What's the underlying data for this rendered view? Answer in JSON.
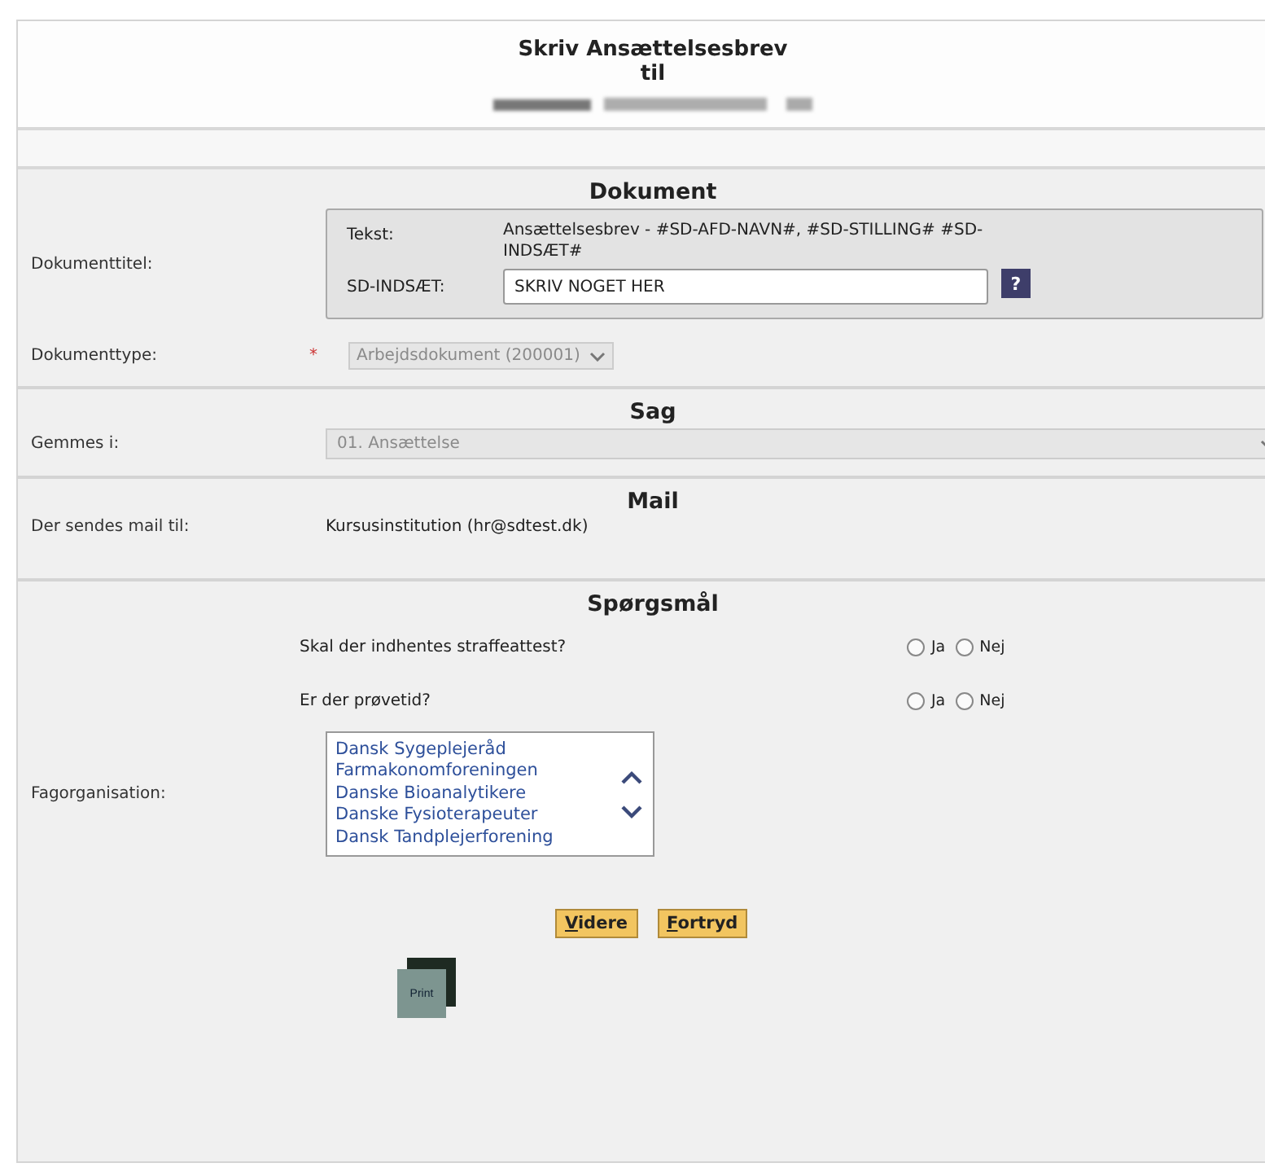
{
  "header": {
    "title": "Skriv Ansættelsesbrev",
    "subtitle": "til"
  },
  "document": {
    "heading": "Dokument",
    "title_label": "Dokumenttitel:",
    "text_label": "Tekst:",
    "text_value": "Ansættelsesbrev - #SD-AFD-NAVN#, #SD-STILLING# #SD-INDSÆT#",
    "insert_label": "SD-INDSÆT:",
    "insert_value": "SKRIV NOGET HER",
    "help": "?",
    "type_label": "Dokumenttype:",
    "required_mark": "*",
    "type_value": "Arbejdsdokument (200001)",
    "type_disabled": true
  },
  "case": {
    "heading": "Sag",
    "label": "Gemmes i:",
    "value": "01. Ansættelse",
    "disabled": true
  },
  "mail": {
    "heading": "Mail",
    "label": "Der sendes mail til:",
    "value": "Kursusinstitution (hr@sdtest.dk)"
  },
  "questions": {
    "heading": "Spørgsmål",
    "items": [
      {
        "text": "Skal der indhentes straffeattest?",
        "options": [
          {
            "label": "Ja",
            "selected": false
          },
          {
            "label": "Nej",
            "selected": false
          }
        ]
      },
      {
        "text": "Er der prøvetid?",
        "options": [
          {
            "label": "Ja",
            "selected": false
          },
          {
            "label": "Nej",
            "selected": false
          }
        ]
      }
    ],
    "org_label": "Fagorganisation:",
    "org_options": [
      {
        "label": "Dansk Sygeplejeråd",
        "selected": false
      },
      {
        "label": "Farmakonomforeningen",
        "selected": false
      },
      {
        "label": "Danske Bioanalytikere",
        "selected": false
      },
      {
        "label": "Danske Fysioterapeuter",
        "selected": false
      },
      {
        "label": "Dansk Tandplejerforening",
        "selected": false
      }
    ]
  },
  "buttons": [
    "Videre",
    "Fortryd"
  ],
  "print": "Print"
}
